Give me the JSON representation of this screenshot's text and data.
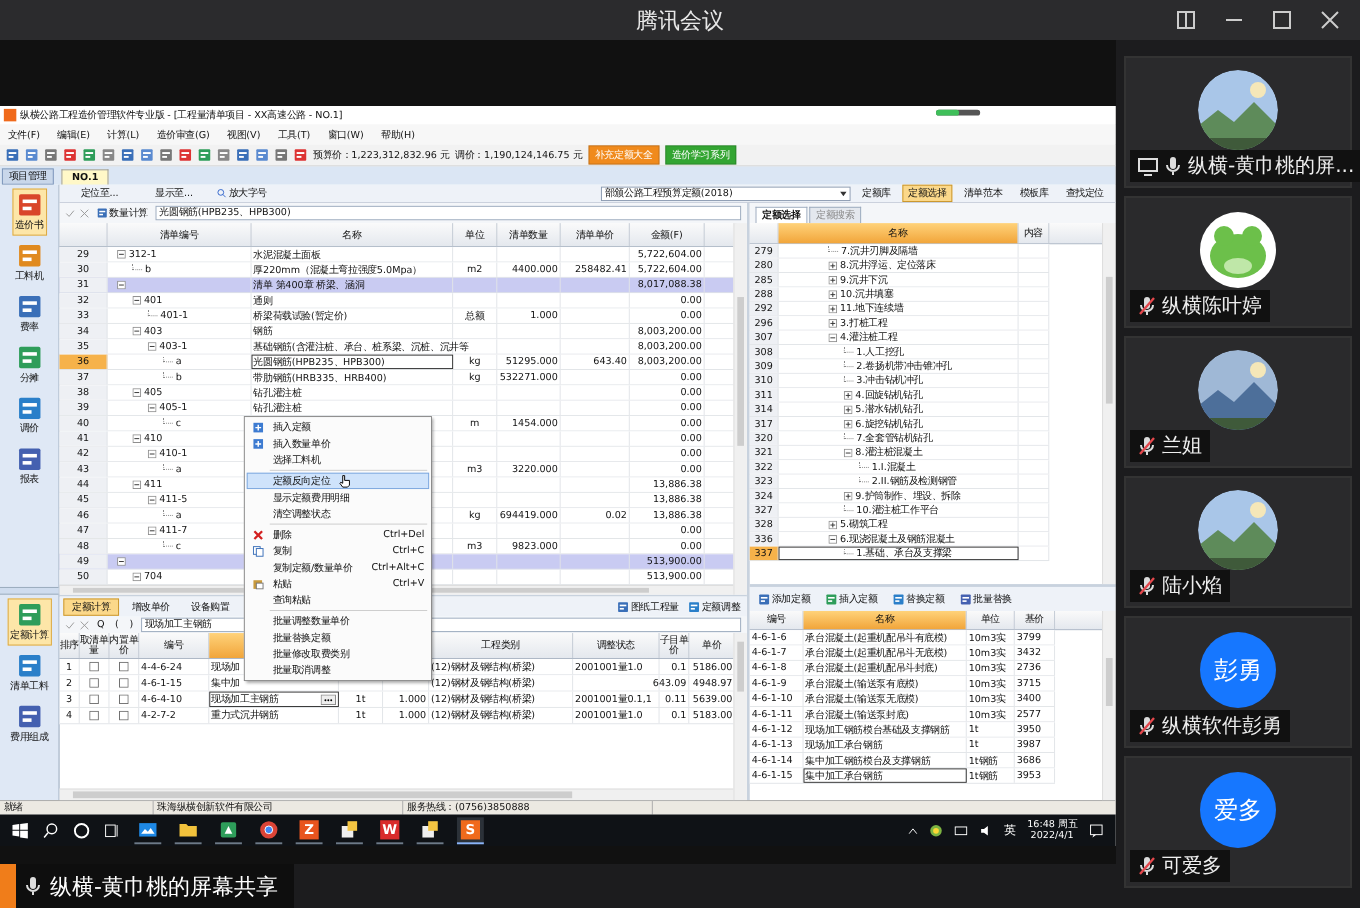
{
  "meeting": {
    "title": "腾讯会议",
    "share_caption": "纵横-黄巾桃的屏幕共享"
  },
  "participants": [
    {
      "name": "纵横-黄巾桃的屏...",
      "muted": false,
      "sharing": true
    },
    {
      "name": "纵横陈叶婷",
      "muted": true,
      "sharing": false,
      "avatar": {
        "kind": "cartoon"
      }
    },
    {
      "name": "兰姐",
      "muted": true,
      "sharing": false
    },
    {
      "name": "陆小焰",
      "muted": true,
      "sharing": false
    },
    {
      "name": "纵横软件彭勇",
      "muted": true,
      "sharing": false,
      "avatar": {
        "kind": "initials",
        "text": "彭勇"
      }
    },
    {
      "name": "可爱多",
      "muted": true,
      "sharing": false,
      "avatar": {
        "kind": "initials",
        "text": "爱多"
      }
    }
  ],
  "app": {
    "title": "纵横公路工程造价管理软件专业版 - [工程量清单项目 - XX高速公路 - NO.1]",
    "menu": [
      "文件(F)",
      "编辑(E)",
      "计算(L)",
      "造价审查(G)",
      "视图(V)",
      "工具(T)",
      "窗口(W)",
      "帮助(H)"
    ],
    "prices": [
      "预算价：1,223,312,832.96 元",
      "调价：1,190,124,146.75 元"
    ],
    "promo_buttons": [
      {
        "label": "补充定额大全",
        "color": "#f08a1c"
      },
      {
        "label": "造价学习系列",
        "color": "#33a532"
      }
    ],
    "side_tab": "项目管理",
    "doc_tabs": [
      {
        "label": "NO.1",
        "selected": true
      }
    ],
    "sub_toolbar": {
      "items": [
        "定位至...",
        "显示至..."
      ],
      "search": "放大字号",
      "library": "部颁公路工程预算定额(2018)",
      "buttons": [
        {
          "label": "定额库",
          "selected": false
        },
        {
          "label": "定额选择",
          "selected": true
        },
        {
          "label": "清单范本",
          "selected": false
        },
        {
          "label": "模板库",
          "selected": false
        },
        {
          "label": "查找定位",
          "selected": false
        }
      ]
    },
    "formula_bar": {
      "button": "数量计算",
      "value": "光圆钢筋(HPB235、HPB300)"
    },
    "sidebar": [
      {
        "label": "造价书",
        "selected": true
      },
      {
        "label": "工料机",
        "selected": false
      },
      {
        "label": "费率",
        "selected": false
      },
      {
        "label": "分摊",
        "selected": false
      },
      {
        "label": "调价",
        "selected": false
      },
      {
        "label": "报表",
        "selected": false
      }
    ],
    "sidebar_bottom": [
      {
        "label": "定额计算",
        "selected": true
      },
      {
        "label": "清单工料",
        "selected": false
      },
      {
        "label": "费用组成",
        "selected": false
      }
    ]
  },
  "bill_table": {
    "columns": [
      "清单编号",
      "名称",
      "单位",
      "清单数量",
      "清单单价",
      "金额(F)"
    ],
    "rows": [
      {
        "no": "29",
        "kind": "item",
        "code": "312-1",
        "name": "水泥混凝土面板",
        "amount": "5,722,604.00",
        "selected": false,
        "expanded": true,
        "children": [
          {
            "no": "30",
            "kind": "item",
            "code": "b",
            "name": "厚220mm（混凝土弯拉强度5.0Mpa）",
            "unit": "m2",
            "qty": "4400.000",
            "price": "258482.41",
            "amount": "5,722,604.00",
            "selected": false
          }
        ]
      },
      {
        "no": "31",
        "kind": "chapter",
        "name": "清单 第400章 桥梁、涵洞",
        "amount": "8,017,088.38",
        "selected": false,
        "expanded": true,
        "children": [
          {
            "no": "32",
            "kind": "item",
            "code": "401",
            "name": "通则",
            "amount": "0.00",
            "selected": false,
            "expanded": true,
            "children": [
              {
                "no": "33",
                "kind": "item",
                "code": "401-1",
                "name": "桥梁荷载试验(暂定价)",
                "unit": "总额",
                "qty": "1.000",
                "amount": "0.00",
                "selected": false
              }
            ]
          },
          {
            "no": "34",
            "kind": "item",
            "code": "403",
            "name": "钢筋",
            "amount": "8,003,200.00",
            "selected": false,
            "expanded": true,
            "children": [
              {
                "no": "35",
                "kind": "item",
                "code": "403-1",
                "name": "基础钢筋(含灌注桩、承台、桩系梁、沉桩、沉井等",
                "amount": "8,003,200.00",
                "selected": false,
                "expanded": true,
                "children": [
                  {
                    "no": "36",
                    "kind": "item",
                    "code": "a",
                    "name": "光圆钢筋(HPB235、HPB300)",
                    "unit": "kg",
                    "qty": "51295.000",
                    "price": "643.40",
                    "amount": "8,003,200.00",
                    "selected": true
                  },
                  {
                    "no": "37",
                    "kind": "item",
                    "code": "b",
                    "name": "带肋钢筋(HRB335、HRB400)",
                    "unit": "kg",
                    "qty": "532271.000",
                    "amount": "0.00",
                    "selected": false
                  }
                ]
              }
            ]
          },
          {
            "no": "38",
            "kind": "item",
            "code": "405",
            "name": "钻孔灌注桩",
            "amount": "0.00",
            "selected": false,
            "expanded": true,
            "children": [
              {
                "no": "39",
                "kind": "item",
                "code": "405-1",
                "name": "钻孔灌注桩",
                "amount": "0.00",
                "selected": false,
                "expanded": true,
                "children": [
                  {
                    "no": "40",
                    "kind": "item",
                    "code": "c",
                    "unit": "m",
                    "qty": "1454.000",
                    "amount": "0.00",
                    "selected": false
                  }
                ]
              }
            ]
          },
          {
            "no": "41",
            "kind": "item",
            "code": "410",
            "amount": "0.00",
            "selected": false,
            "expanded": true,
            "children": [
              {
                "no": "42",
                "kind": "item",
                "code": "410-1",
                "amount": "0.00",
                "selected": false,
                "expanded": true,
                "children": [
                  {
                    "no": "43",
                    "kind": "item",
                    "code": "a",
                    "unit": "m3",
                    "qty": "3220.000",
                    "amount": "0.00",
                    "selected": false
                  }
                ]
              }
            ]
          },
          {
            "no": "44",
            "kind": "item",
            "code": "411",
            "amount": "13,886.38",
            "selected": false,
            "expanded": true,
            "children": [
              {
                "no": "45",
                "kind": "item",
                "code": "411-5",
                "amount": "13,886.38",
                "selected": false,
                "expanded": true,
                "children": [
                  {
                    "no": "46",
                    "kind": "item",
                    "code": "a",
                    "unit": "kg",
                    "qty": "694419.000",
                    "price": "0.02",
                    "amount": "13,886.38",
                    "selected": false
                  }
                ]
              },
              {
                "no": "47",
                "kind": "item",
                "code": "411-7",
                "amount": "0.00",
                "selected": false,
                "expanded": true,
                "children": [
                  {
                    "no": "48",
                    "kind": "item",
                    "code": "c",
                    "unit": "m3",
                    "qty": "9823.000",
                    "amount": "0.00",
                    "selected": false
                  }
                ]
              }
            ]
          }
        ]
      },
      {
        "no": "49",
        "kind": "chapter",
        "amount": "513,900.00",
        "selected": false,
        "expanded": true,
        "children": [
          {
            "no": "50",
            "kind": "item",
            "code": "704",
            "amount": "513,900.00",
            "selected": false,
            "expanded": true
          }
        ]
      }
    ]
  },
  "context_menu": {
    "groups": [
      [
        {
          "label": "插入定额",
          "selected": false
        },
        {
          "label": "插入数量单价",
          "selected": false
        },
        {
          "label": "选择工料机",
          "selected": false
        }
      ],
      [
        {
          "label": "定额反向定位",
          "selected": true
        },
        {
          "label": "显示定额费用明细",
          "selected": false
        },
        {
          "label": "清空调整状态",
          "selected": false
        }
      ],
      [
        {
          "label": "删除",
          "shortcut": "Ctrl+Del",
          "selected": false
        },
        {
          "label": "复制",
          "shortcut": "Ctrl+C",
          "selected": false
        },
        {
          "label": "复制定额/数量单价",
          "shortcut": "Ctrl+Alt+C",
          "selected": false
        },
        {
          "label": "粘贴",
          "shortcut": "Ctrl+V",
          "selected": false
        },
        {
          "label": "查询粘贴",
          "selected": false
        }
      ],
      [
        {
          "label": "批量调整数量单价",
          "selected": false
        },
        {
          "label": "批量替换定额",
          "selected": false
        },
        {
          "label": "批量修改取费类别",
          "selected": false
        },
        {
          "label": "批量取消调整",
          "selected": false
        }
      ]
    ]
  },
  "quota_panel": {
    "tabs": [
      {
        "label": "定额计算",
        "selected": true
      },
      {
        "label": "增改单价",
        "selected": false
      },
      {
        "label": "设备购置",
        "selected": false
      }
    ],
    "buttons": [
      "图纸工程量",
      "定额调整"
    ],
    "symbols": [
      "Q",
      "(",
      ")"
    ],
    "formula": "现场加工主钢筋",
    "columns": [
      "排序",
      "取清单量",
      "内置单价",
      "编号",
      "工程类别",
      "调整状态",
      "子目单价",
      "单价"
    ],
    "rows": [
      {
        "no": "1",
        "take_bill_qty": false,
        "builtin_price": false,
        "code": "4-4-6-24",
        "name": "现场加",
        "category": "(12)钢材及钢结构(桥梁)",
        "adjust": "2001001量1.0",
        "sub_price": "0.1",
        "price": "5186.00",
        "selected": false
      },
      {
        "no": "2",
        "take_bill_qty": false,
        "builtin_price": false,
        "code": "4-6-1-15",
        "name": "集中加",
        "category": "(12)钢材及钢结构(桥梁)",
        "sub_price": "643.09",
        "price": "4948.97",
        "selected": false
      },
      {
        "no": "3",
        "take_bill_qty": false,
        "builtin_price": false,
        "code": "4-6-4-10",
        "name": "现场加工主钢筋",
        "unit": "1t",
        "qty": "1.000",
        "category": "(12)钢材及钢结构(桥梁)",
        "adjust": "2001001量0.1,1",
        "sub_price": "0.11",
        "price": "5639.00",
        "selected": true
      },
      {
        "no": "4",
        "take_bill_qty": false,
        "builtin_price": false,
        "code": "4-2-7-2",
        "name": "重力式沉井钢筋",
        "unit": "1t",
        "qty": "1.000",
        "category": "(12)钢材及钢结构(桥梁)",
        "adjust": "2001001量1.0",
        "sub_price": "0.1",
        "price": "5183.00",
        "selected": false
      }
    ]
  },
  "library_tree": {
    "tabs": [
      {
        "label": "定额选择",
        "selected": true
      },
      {
        "label": "定额搜索",
        "selected": false
      }
    ],
    "columns": [
      "名称",
      "内容"
    ],
    "rows": [
      {
        "no": "279",
        "name": "7.沉井刃脚及隔墙",
        "selected": false
      },
      {
        "no": "280",
        "name": "8.沉井浮运、定位落床",
        "expanded": false,
        "selected": false
      },
      {
        "no": "285",
        "name": "9.沉井下沉",
        "expanded": false,
        "selected": false
      },
      {
        "no": "288",
        "name": "10.沉井填塞",
        "expanded": false,
        "selected": false
      },
      {
        "no": "292",
        "name": "11.地下连续墙",
        "expanded": false,
        "selected": false
      },
      {
        "no": "296",
        "name": "3.打桩工程",
        "expanded": false,
        "selected": false
      },
      {
        "no": "307",
        "name": "4.灌注桩工程",
        "expanded": true,
        "selected": false,
        "children": [
          {
            "no": "308",
            "name": "1.人工挖孔",
            "selected": false
          },
          {
            "no": "309",
            "name": "2.卷扬机带冲击锥冲孔",
            "selected": false
          },
          {
            "no": "310",
            "name": "3.冲击钻机冲孔",
            "selected": false
          },
          {
            "no": "311",
            "name": "4.回旋钻机钻孔",
            "expanded": false,
            "selected": false
          },
          {
            "no": "314",
            "name": "5.潜水钻机钻孔",
            "expanded": false,
            "selected": false
          },
          {
            "no": "317",
            "name": "6.旋挖钻机钻孔",
            "expanded": false,
            "selected": false
          },
          {
            "no": "320",
            "name": "7.全套管钻机钻孔",
            "selected": false
          },
          {
            "no": "321",
            "name": "8.灌注桩混凝土",
            "expanded": true,
            "selected": false,
            "children": [
              {
                "no": "322",
                "name": "1.I.混凝土",
                "selected": false
              },
              {
                "no": "323",
                "name": "2.II.钢筋及检测钢管",
                "selected": false
              }
            ]
          },
          {
            "no": "324",
            "name": "9.护筒制作、埋设、拆除",
            "expanded": false,
            "selected": false
          },
          {
            "no": "327",
            "name": "10.灌注桩工作平台",
            "selected": false
          }
        ]
      },
      {
        "no": "328",
        "name": "5.砌筑工程",
        "expanded": false,
        "selected": false
      },
      {
        "no": "336",
        "name": "6.现浇混凝土及钢筋混凝土",
        "expanded": true,
        "selected": false,
        "children": [
          {
            "no": "337",
            "name": "1.基础、承台及支撑梁",
            "selected": true
          }
        ]
      }
    ]
  },
  "library_list": {
    "buttons": [
      "添加定额",
      "插入定额",
      "替换定额",
      "批量替换"
    ],
    "columns": [
      "编号",
      "名称",
      "单位",
      "基价"
    ],
    "rows": [
      {
        "code": "4-6-1-6",
        "name": "承台混凝土(起重机配吊斗有底模)",
        "unit": "10m3实",
        "base": "3799",
        "selected": false
      },
      {
        "code": "4-6-1-7",
        "name": "承台混凝土(起重机配吊斗无底模)",
        "unit": "10m3实",
        "base": "3432",
        "selected": false
      },
      {
        "code": "4-6-1-8",
        "name": "承台混凝土(起重机配吊斗封底)",
        "unit": "10m3实",
        "base": "2736",
        "selected": false
      },
      {
        "code": "4-6-1-9",
        "name": "承台混凝土(输送泵有底模)",
        "unit": "10m3实",
        "base": "3715",
        "selected": false
      },
      {
        "code": "4-6-1-10",
        "name": "承台混凝土(输送泵无底模)",
        "unit": "10m3实",
        "base": "3400",
        "selected": false
      },
      {
        "code": "4-6-1-11",
        "name": "承台混凝土(输送泵封底)",
        "unit": "10m3实",
        "base": "2577",
        "selected": false
      },
      {
        "code": "4-6-1-12",
        "name": "现场加工钢筋模台基础及支撑钢筋",
        "unit": "1t",
        "base": "3950",
        "selected": false
      },
      {
        "code": "4-6-1-13",
        "name": "现场加工承台钢筋",
        "unit": "1t",
        "base": "3987",
        "selected": false
      },
      {
        "code": "4-6-1-14",
        "name": "集中加工钢筋模台及支撑钢筋",
        "unit": "1t钢筋",
        "base": "3686",
        "selected": false
      },
      {
        "code": "4-6-1-15",
        "name": "集中加工承台钢筋",
        "unit": "1t钢筋",
        "base": "3953",
        "selected": true
      }
    ]
  },
  "status_bar": [
    "就绪",
    "珠海纵横创新软件有限公司",
    "服务热线：(0756)3850888"
  ],
  "taskbar": {
    "apps": [
      {
        "kind": "store",
        "color": "#1e88e5",
        "active": false
      },
      {
        "kind": "folder",
        "color": "#f2c23c",
        "active": false
      },
      {
        "kind": "app",
        "color": "#2e9d5a",
        "active": false
      },
      {
        "kind": "chrome",
        "color": "#db4437",
        "active": false
      },
      {
        "kind": "letter",
        "glyph": "Z",
        "color": "#e8541e",
        "active": false
      },
      {
        "kind": "help",
        "color": "#f4c542",
        "active": false
      },
      {
        "kind": "letter",
        "glyph": "W",
        "color": "#d92b2b",
        "active": false
      },
      {
        "kind": "help",
        "color": "#f4c542",
        "active": false
      },
      {
        "kind": "letter",
        "glyph": "S",
        "color": "#f06a1c",
        "active": true
      }
    ],
    "ime": "英",
    "time": "16:48 周五",
    "date": "2022/4/1"
  }
}
